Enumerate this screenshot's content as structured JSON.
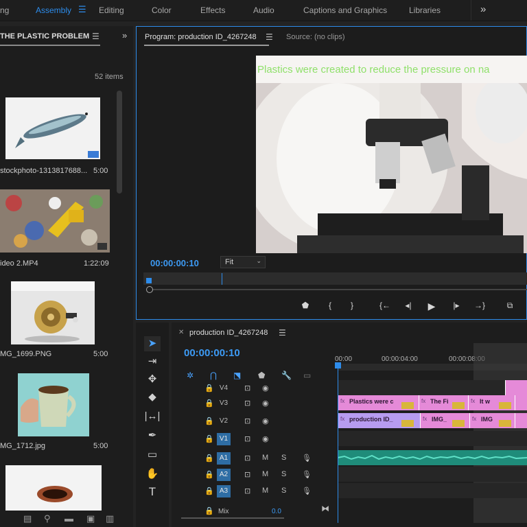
{
  "workspaces": {
    "items": [
      "ng",
      "Assembly",
      "Editing",
      "Color",
      "Effects",
      "Audio",
      "Captions and Graphics",
      "Libraries"
    ],
    "active": "Assembly",
    "more_icon": "chevron-double-right-icon"
  },
  "project": {
    "tab_title": "THE PLASTIC PROBLEM",
    "item_count": "52 items",
    "items": [
      {
        "name": "stockphoto-1313817688...",
        "duration": "5:00"
      },
      {
        "name": "ideo 2.MP4",
        "duration": "1:22:09"
      },
      {
        "name": "MG_1699.PNG",
        "duration": "5:00"
      },
      {
        "name": "MG_1712.jpg",
        "duration": "5:00"
      }
    ]
  },
  "program": {
    "tab_title": "Program: production ID_4267248",
    "source_tab": "Source: (no clips)",
    "title_overlay": "Plastics were created to reduce the pressure on na",
    "timecode": "00:00:00:10",
    "fit": "Fit"
  },
  "timeline": {
    "sequence_name": "production ID_4267248",
    "timecode": "00:00:00:10",
    "ticks": [
      "00:00",
      "00:00:04:00",
      "00:00:08:00"
    ],
    "tracks": [
      {
        "name": "V4",
        "on": false
      },
      {
        "name": "V3",
        "on": false
      },
      {
        "name": "V2",
        "on": false
      },
      {
        "name": "V1",
        "on": true
      },
      {
        "name": "A1",
        "on": true
      },
      {
        "name": "A2",
        "on": true
      },
      {
        "name": "A3",
        "on": true
      }
    ],
    "v3_clips": [
      "Plastics were c",
      "The Fi",
      "It w"
    ],
    "v2_clips": [
      "production ID_",
      "IMG_",
      "IMG"
    ],
    "fx_label": "fx",
    "mix_label": "Mix",
    "mix_value": "0.0",
    "audio_m": "M",
    "audio_s": "S"
  },
  "colors": {
    "accent": "#2d8ceb",
    "clip_pink": "#e58ad8",
    "audio_teal": "#1f8c7a",
    "title_green": "#8fe06a"
  }
}
